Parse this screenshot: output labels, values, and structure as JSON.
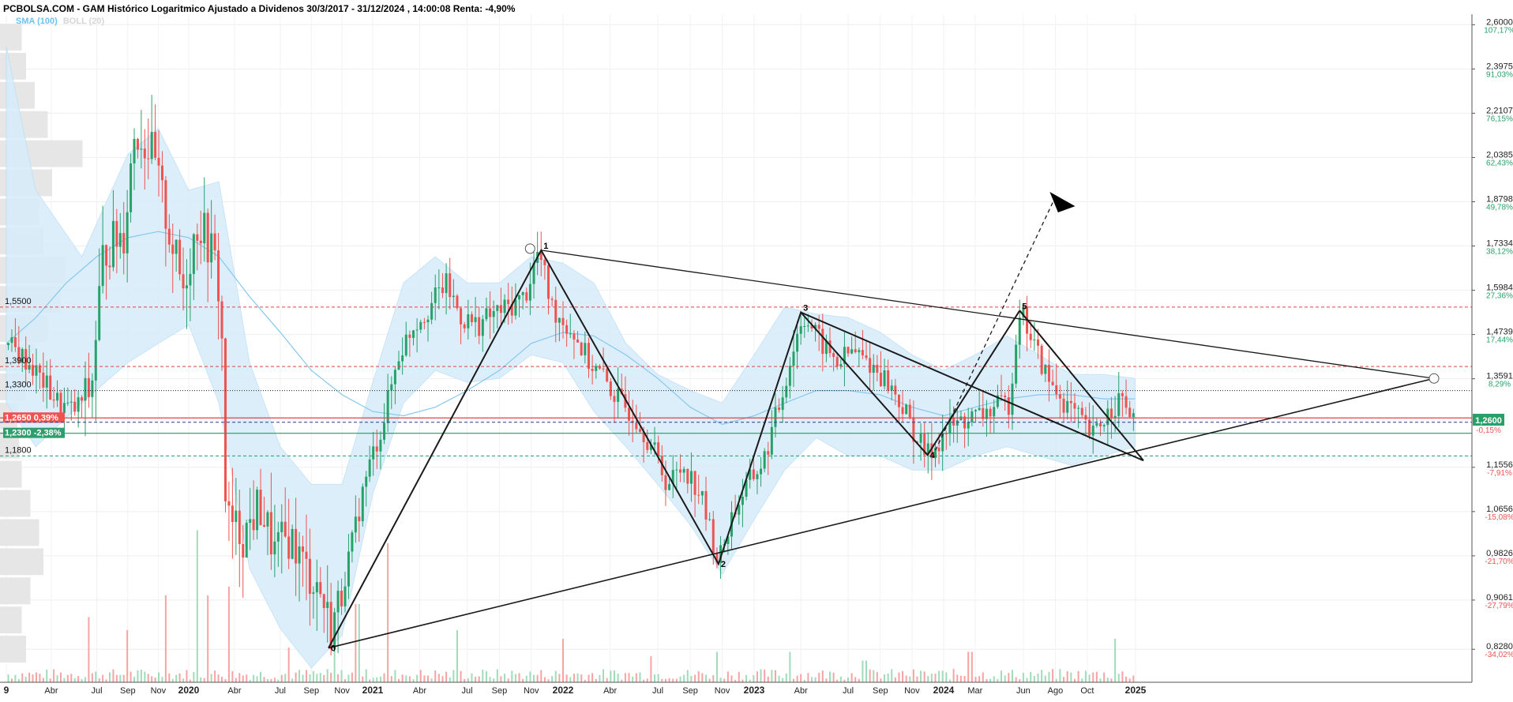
{
  "title": "PCBOLSA.COM - GAM Histórico Logaritmico Ajustado a Dividenos 30/3/2017 - 31/12/2024 , 14:00:08 Renta: -4,90%",
  "legend": {
    "sma": "SMA (100)",
    "boll": "BOLL (20)"
  },
  "colors": {
    "up": "#26a269",
    "down": "#ef5350",
    "band": "#d6ecfa",
    "sma": "#86c8ee",
    "pattern": "#1a1a1a",
    "pct_up": "#26a269",
    "pct_down": "#ef5350",
    "last_price_bg": "#26a269",
    "red_level_bg": "#ef5350",
    "green_level_bg": "#2e9e6e"
  },
  "chart_data": {
    "type": "candlestick",
    "scale": "log",
    "ylim": [
      0.8,
      2.62
    ],
    "x_ticks": [
      "9",
      "Abr",
      "Jul",
      "Sep",
      "Nov",
      "2020",
      "Abr",
      "Jul",
      "Sep",
      "Nov",
      "2021",
      "Abr",
      "Jul",
      "Sep",
      "Nov",
      "2022",
      "Abr",
      "Jul",
      "Sep",
      "Nov",
      "2023",
      "Abr",
      "Jul",
      "Sep",
      "Nov",
      "2024",
      "Mar",
      "Jun",
      "Ago",
      "Oct",
      "2025"
    ],
    "x_tick_dates": [
      "2019-01-01",
      "2019-04-01",
      "2019-07-01",
      "2019-09-01",
      "2019-11-01",
      "2020-01-01",
      "2020-04-01",
      "2020-07-01",
      "2020-09-01",
      "2020-11-01",
      "2021-01-01",
      "2021-04-01",
      "2021-07-01",
      "2021-09-01",
      "2021-11-01",
      "2022-01-01",
      "2022-04-01",
      "2022-07-01",
      "2022-09-01",
      "2022-11-01",
      "2023-01-01",
      "2023-04-01",
      "2023-07-01",
      "2023-09-01",
      "2023-11-01",
      "2024-01-01",
      "2024-03-01",
      "2024-06-01",
      "2024-08-01",
      "2024-10-01",
      "2025-01-01"
    ],
    "y_ticks": [
      {
        "price": "2,6000",
        "pct": "107,17%",
        "v": 2.6
      },
      {
        "price": "2,3975",
        "pct": "91,03%",
        "v": 2.3975
      },
      {
        "price": "2,2107",
        "pct": "76,15%",
        "v": 2.2107
      },
      {
        "price": "2,0385",
        "pct": "62,43%",
        "v": 2.0385
      },
      {
        "price": "1,8798",
        "pct": "49,78%",
        "v": 1.8798
      },
      {
        "price": "1,7334",
        "pct": "38,12%",
        "v": 1.7334
      },
      {
        "price": "1,5984",
        "pct": "27,36%",
        "v": 1.5984
      },
      {
        "price": "1,4739",
        "pct": "17,44%",
        "v": 1.4739
      },
      {
        "price": "1,3591",
        "pct": "8,29%",
        "v": 1.3591
      },
      {
        "price": "1,1556",
        "pct": "-7,91%",
        "v": 1.1556
      },
      {
        "price": "1,0656",
        "pct": "-15,08%",
        "v": 1.0656
      },
      {
        "price": "0,9826",
        "pct": "-21,70%",
        "v": 0.9826
      },
      {
        "price": "0,9061",
        "pct": "-27,79%",
        "v": 0.9061
      },
      {
        "price": "0,8280",
        "pct": "-34,02%",
        "v": 0.828
      }
    ],
    "last_price": {
      "label": "1,2600",
      "pct": "-0,15%",
      "v": 1.26
    },
    "levels": [
      {
        "label": "1,5500",
        "v": 1.55,
        "style": "red-dash",
        "labelled": true
      },
      {
        "label": "1,3900",
        "v": 1.39,
        "style": "red-dash",
        "labelled": true
      },
      {
        "label": "1,3300",
        "v": 1.33,
        "style": "black-dot",
        "labelled": true
      },
      {
        "label": "1,2650  0,39%",
        "v": 1.265,
        "style": "red-solid",
        "labelled": true,
        "box": "red"
      },
      {
        "label": "1,2300  -2,38%",
        "v": 1.23,
        "style": "green-solid",
        "labelled": true,
        "box": "green"
      },
      {
        "label": "1,1800",
        "v": 1.18,
        "style": "green-dash",
        "labelled": true
      },
      {
        "label": "",
        "v": 1.255,
        "style": "navy-dash",
        "labelled": false
      }
    ],
    "series": [
      {
        "name": "SMA (100)",
        "points": [
          [
            "2019-01-01",
            1.45
          ],
          [
            "2019-03-01",
            1.52
          ],
          [
            "2019-05-01",
            1.62
          ],
          [
            "2019-07-01",
            1.7
          ],
          [
            "2019-09-01",
            1.76
          ],
          [
            "2019-11-01",
            1.78
          ],
          [
            "2020-01-01",
            1.76
          ],
          [
            "2020-03-01",
            1.7
          ],
          [
            "2020-05-01",
            1.58
          ],
          [
            "2020-07-01",
            1.48
          ],
          [
            "2020-09-01",
            1.38
          ],
          [
            "2020-11-01",
            1.32
          ],
          [
            "2021-01-01",
            1.28
          ],
          [
            "2021-03-01",
            1.27
          ],
          [
            "2021-05-01",
            1.29
          ],
          [
            "2021-07-01",
            1.33
          ],
          [
            "2021-09-01",
            1.38
          ],
          [
            "2021-11-01",
            1.45
          ],
          [
            "2022-01-01",
            1.48
          ],
          [
            "2022-03-01",
            1.47
          ],
          [
            "2022-05-01",
            1.42
          ],
          [
            "2022-07-01",
            1.36
          ],
          [
            "2022-09-01",
            1.29
          ],
          [
            "2022-11-01",
            1.25
          ],
          [
            "2023-01-01",
            1.27
          ],
          [
            "2023-03-01",
            1.3
          ],
          [
            "2023-05-01",
            1.33
          ],
          [
            "2023-07-01",
            1.33
          ],
          [
            "2023-09-01",
            1.32
          ],
          [
            "2023-11-01",
            1.29
          ],
          [
            "2024-01-01",
            1.27
          ],
          [
            "2024-03-01",
            1.29
          ],
          [
            "2024-05-01",
            1.31
          ],
          [
            "2024-07-01",
            1.32
          ],
          [
            "2024-09-01",
            1.32
          ],
          [
            "2024-11-01",
            1.31
          ],
          [
            "2024-12-31",
            1.31
          ]
        ]
      },
      {
        "name": "BOLL (20)",
        "upper": [
          [
            "2019-01-01",
            2.5
          ],
          [
            "2019-03-01",
            1.92
          ],
          [
            "2019-06-01",
            1.7
          ],
          [
            "2019-09-01",
            2.05
          ],
          [
            "2019-11-01",
            2.15
          ],
          [
            "2020-01-01",
            1.92
          ],
          [
            "2020-03-01",
            1.95
          ],
          [
            "2020-05-01",
            1.4
          ],
          [
            "2020-07-01",
            1.2
          ],
          [
            "2020-09-01",
            1.12
          ],
          [
            "2020-11-01",
            1.12
          ],
          [
            "2021-01-01",
            1.35
          ],
          [
            "2021-03-01",
            1.62
          ],
          [
            "2021-05-01",
            1.7
          ],
          [
            "2021-07-01",
            1.62
          ],
          [
            "2021-09-01",
            1.62
          ],
          [
            "2021-11-01",
            1.7
          ],
          [
            "2022-01-01",
            1.68
          ],
          [
            "2022-03-01",
            1.62
          ],
          [
            "2022-05-01",
            1.45
          ],
          [
            "2022-07-01",
            1.37
          ],
          [
            "2022-09-01",
            1.33
          ],
          [
            "2022-11-01",
            1.3
          ],
          [
            "2023-01-01",
            1.42
          ],
          [
            "2023-03-01",
            1.55
          ],
          [
            "2023-05-01",
            1.53
          ],
          [
            "2023-07-01",
            1.52
          ],
          [
            "2023-09-01",
            1.48
          ],
          [
            "2023-11-01",
            1.42
          ],
          [
            "2024-01-01",
            1.38
          ],
          [
            "2024-03-01",
            1.42
          ],
          [
            "2024-05-01",
            1.47
          ],
          [
            "2024-07-01",
            1.42
          ],
          [
            "2024-09-01",
            1.37
          ],
          [
            "2024-11-01",
            1.37
          ],
          [
            "2024-12-31",
            1.36
          ]
        ],
        "lower": [
          [
            "2019-01-01",
            1.3
          ],
          [
            "2019-03-01",
            1.2
          ],
          [
            "2019-06-01",
            1.3
          ],
          [
            "2019-09-01",
            1.4
          ],
          [
            "2019-11-01",
            1.45
          ],
          [
            "2020-01-01",
            1.5
          ],
          [
            "2020-03-01",
            1.3
          ],
          [
            "2020-05-01",
            0.96
          ],
          [
            "2020-07-01",
            0.86
          ],
          [
            "2020-09-01",
            0.8
          ],
          [
            "2020-11-01",
            0.85
          ],
          [
            "2021-01-01",
            1.1
          ],
          [
            "2021-03-01",
            1.3
          ],
          [
            "2021-05-01",
            1.38
          ],
          [
            "2021-07-01",
            1.35
          ],
          [
            "2021-09-01",
            1.36
          ],
          [
            "2021-11-01",
            1.42
          ],
          [
            "2022-01-01",
            1.4
          ],
          [
            "2022-03-01",
            1.28
          ],
          [
            "2022-05-01",
            1.2
          ],
          [
            "2022-07-01",
            1.12
          ],
          [
            "2022-09-01",
            1.04
          ],
          [
            "2022-11-01",
            0.95
          ],
          [
            "2023-01-01",
            1.05
          ],
          [
            "2023-03-01",
            1.15
          ],
          [
            "2023-05-01",
            1.22
          ],
          [
            "2023-07-01",
            1.18
          ],
          [
            "2023-09-01",
            1.18
          ],
          [
            "2023-11-01",
            1.15
          ],
          [
            "2024-01-01",
            1.15
          ],
          [
            "2024-03-01",
            1.18
          ],
          [
            "2024-05-01",
            1.2
          ],
          [
            "2024-07-01",
            1.18
          ],
          [
            "2024-09-01",
            1.16
          ],
          [
            "2024-11-01",
            1.18
          ],
          [
            "2024-12-31",
            1.2
          ]
        ]
      },
      {
        "name": "Precio",
        "candle_anchors": [
          [
            "2019-01-01",
            1.45
          ],
          [
            "2019-02-15",
            1.4
          ],
          [
            "2019-04-15",
            1.3
          ],
          [
            "2019-05-15",
            1.28
          ],
          [
            "2019-06-20",
            1.33
          ],
          [
            "2019-07-15",
            1.72
          ],
          [
            "2019-08-25",
            1.78
          ],
          [
            "2019-09-15",
            2.15
          ],
          [
            "2019-10-20",
            2.05
          ],
          [
            "2019-11-20",
            1.8
          ],
          [
            "2019-12-20",
            1.6
          ],
          [
            "2020-01-20",
            1.82
          ],
          [
            "2020-02-20",
            1.7
          ],
          [
            "2020-03-05",
            1.55
          ],
          [
            "2020-03-15",
            1.05
          ],
          [
            "2020-04-20",
            1.02
          ],
          [
            "2020-05-20",
            1.08
          ],
          [
            "2020-06-20",
            0.99
          ],
          [
            "2020-07-20",
            1.02
          ],
          [
            "2020-08-20",
            0.96
          ],
          [
            "2020-09-15",
            0.93
          ],
          [
            "2020-10-10",
            0.86
          ],
          [
            "2020-10-25",
            0.9
          ],
          [
            "2020-11-20",
            1.0
          ],
          [
            "2020-12-20",
            1.14
          ],
          [
            "2021-01-20",
            1.25
          ],
          [
            "2021-02-20",
            1.42
          ],
          [
            "2021-03-20",
            1.5
          ],
          [
            "2021-04-20",
            1.55
          ],
          [
            "2021-05-20",
            1.62
          ],
          [
            "2021-06-20",
            1.52
          ],
          [
            "2021-07-20",
            1.5
          ],
          [
            "2021-08-20",
            1.53
          ],
          [
            "2021-09-20",
            1.55
          ],
          [
            "2021-10-20",
            1.58
          ],
          [
            "2021-11-15",
            1.72
          ],
          [
            "2021-12-10",
            1.55
          ],
          [
            "2022-01-20",
            1.48
          ],
          [
            "2022-02-20",
            1.4
          ],
          [
            "2022-03-20",
            1.36
          ],
          [
            "2022-04-20",
            1.3
          ],
          [
            "2022-05-20",
            1.27
          ],
          [
            "2022-06-20",
            1.2
          ],
          [
            "2022-07-20",
            1.12
          ],
          [
            "2022-08-20",
            1.16
          ],
          [
            "2022-09-20",
            1.1
          ],
          [
            "2022-10-25",
            0.97
          ],
          [
            "2022-11-20",
            1.06
          ],
          [
            "2022-12-20",
            1.12
          ],
          [
            "2023-01-20",
            1.17
          ],
          [
            "2023-02-20",
            1.3
          ],
          [
            "2023-03-20",
            1.45
          ],
          [
            "2023-04-05",
            1.53
          ],
          [
            "2023-05-10",
            1.45
          ],
          [
            "2023-06-10",
            1.4
          ],
          [
            "2023-07-10",
            1.43
          ],
          [
            "2023-08-10",
            1.4
          ],
          [
            "2023-09-10",
            1.36
          ],
          [
            "2023-10-10",
            1.3
          ],
          [
            "2023-11-10",
            1.22
          ],
          [
            "2023-11-30",
            1.18
          ],
          [
            "2024-01-10",
            1.24
          ],
          [
            "2024-02-10",
            1.26
          ],
          [
            "2024-03-10",
            1.27
          ],
          [
            "2024-04-10",
            1.29
          ],
          [
            "2024-05-05",
            1.3
          ],
          [
            "2024-05-25",
            1.55
          ],
          [
            "2024-06-20",
            1.45
          ],
          [
            "2024-07-20",
            1.35
          ],
          [
            "2024-08-20",
            1.3
          ],
          [
            "2024-09-10",
            1.27
          ],
          [
            "2024-10-10",
            1.22
          ],
          [
            "2024-11-10",
            1.28
          ],
          [
            "2024-12-01",
            1.31
          ],
          [
            "2024-12-31",
            1.26
          ]
        ]
      }
    ],
    "pattern": {
      "points": [
        {
          "label": "0",
          "date": "2020-10-05",
          "v": 0.83
        },
        {
          "label": "1",
          "date": "2021-11-20",
          "v": 1.72
        },
        {
          "label": "2",
          "date": "2022-10-25",
          "v": 0.968
        },
        {
          "label": "3",
          "date": "2023-04-01",
          "v": 1.535
        },
        {
          "label": "4",
          "date": "2023-12-01",
          "v": 1.182
        },
        {
          "label": "5",
          "date": "2024-05-25",
          "v": 1.54
        }
      ]
    },
    "volume_profile": [
      0.25,
      0.3,
      0.4,
      0.55,
      0.95,
      0.6,
      0.45,
      0.5,
      0.75,
      0.7,
      0.55,
      0.4,
      0.3,
      0.2,
      0.22,
      0.25,
      0.35,
      0.45,
      0.5,
      0.35,
      0.25,
      0.3
    ],
    "volume_spikes": [
      [
        "2019-06-15",
        0.15
      ],
      [
        "2019-09-01",
        0.12
      ],
      [
        "2019-11-15",
        0.2
      ],
      [
        "2020-01-20",
        0.35
      ],
      [
        "2020-02-10",
        0.2
      ],
      [
        "2020-03-20",
        0.22
      ],
      [
        "2020-07-20",
        0.08
      ],
      [
        "2020-10-15",
        0.1
      ],
      [
        "2020-12-01",
        0.18
      ],
      [
        "2021-02-01",
        0.32
      ],
      [
        "2021-06-10",
        0.12
      ],
      [
        "2022-01-01",
        0.1
      ],
      [
        "2022-06-20",
        0.06
      ],
      [
        "2022-10-20",
        0.07
      ],
      [
        "2023-03-10",
        0.07
      ],
      [
        "2023-08-01",
        0.05
      ],
      [
        "2024-02-20",
        0.07
      ],
      [
        "2024-11-25",
        0.1
      ]
    ]
  }
}
